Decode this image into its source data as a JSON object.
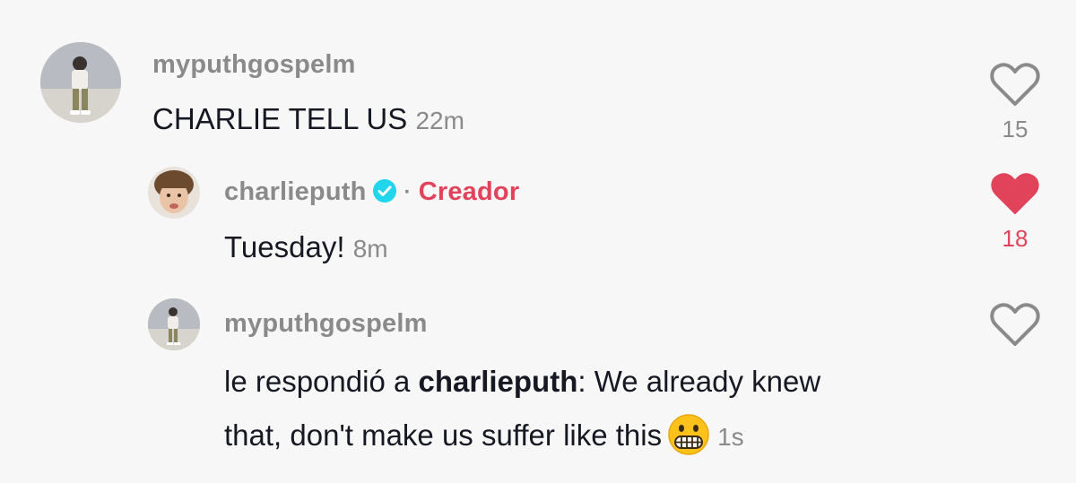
{
  "comments": [
    {
      "username": "myputhgospelm",
      "text": "CHARLIE TELL US",
      "time": "22m",
      "likes": "15",
      "liked": false
    },
    {
      "username": "charlieputh",
      "verified": true,
      "separator": "·",
      "badge": "Creador",
      "text": "Tuesday!",
      "time": "8m",
      "likes": "18",
      "liked": true
    },
    {
      "username": "myputhgospelm",
      "reply_prefix": "le respondió a",
      "reply_to": "charlieputh",
      "text_line1": ": We already knew",
      "text_line2": "that, don't make us suffer like this",
      "emoji": "grimacing-face",
      "time": "1s",
      "likes": "",
      "liked": false
    }
  ],
  "colors": {
    "background": "#f8f7f7",
    "username": "#8a8a8a",
    "text": "#161823",
    "liked": "#e0435a",
    "verified": "#20d5ec"
  }
}
